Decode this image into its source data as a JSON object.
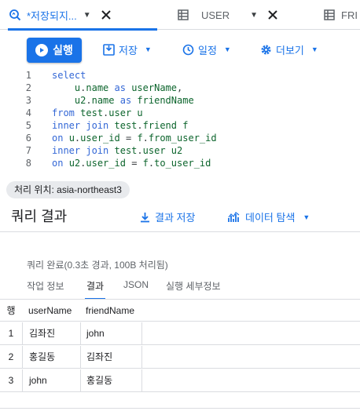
{
  "tabs": [
    {
      "label": "*저장되지...",
      "icon": "query-search-icon",
      "active": true
    },
    {
      "label": "USER",
      "icon": "table-icon",
      "active": false
    },
    {
      "label": "FRI",
      "icon": "table-icon",
      "active": false
    }
  ],
  "toolbar": {
    "run_label": "실행",
    "save_label": "저장",
    "schedule_label": "일정",
    "more_label": "더보기"
  },
  "editor": {
    "lines": [
      {
        "num": "1",
        "code": "select"
      },
      {
        "num": "2",
        "code": "    u.name as userName,"
      },
      {
        "num": "3",
        "code": "    u2.name as friendName"
      },
      {
        "num": "4",
        "code": "from test.user u"
      },
      {
        "num": "5",
        "code": "inner join test.friend f"
      },
      {
        "num": "6",
        "code": "on u.user_id = f.from_user_id"
      },
      {
        "num": "7",
        "code": "inner join test.user u2"
      },
      {
        "num": "8",
        "code": "on u2.user_id = f.to_user_id"
      }
    ]
  },
  "location": "처리 위치: asia-northeast3",
  "results": {
    "title": "쿼리 결과",
    "save_results_label": "결과 저장",
    "explore_data_label": "데이터 탐색",
    "status": "쿼리 완료(0.3초 경과, 100B 처리됨)",
    "tabs": [
      "작업 정보",
      "결과",
      "JSON",
      "실행 세부정보"
    ],
    "active_tab": "결과",
    "columns": [
      "행",
      "userName",
      "friendName"
    ],
    "rows": [
      [
        "1",
        "김좌진",
        "john"
      ],
      [
        "2",
        "홍길동",
        "김좌진"
      ],
      [
        "3",
        "john",
        "홍길동"
      ]
    ]
  },
  "colors": {
    "accent": "#1a73e8",
    "keyword": "#3367d6",
    "code_text": "#0d652d"
  }
}
